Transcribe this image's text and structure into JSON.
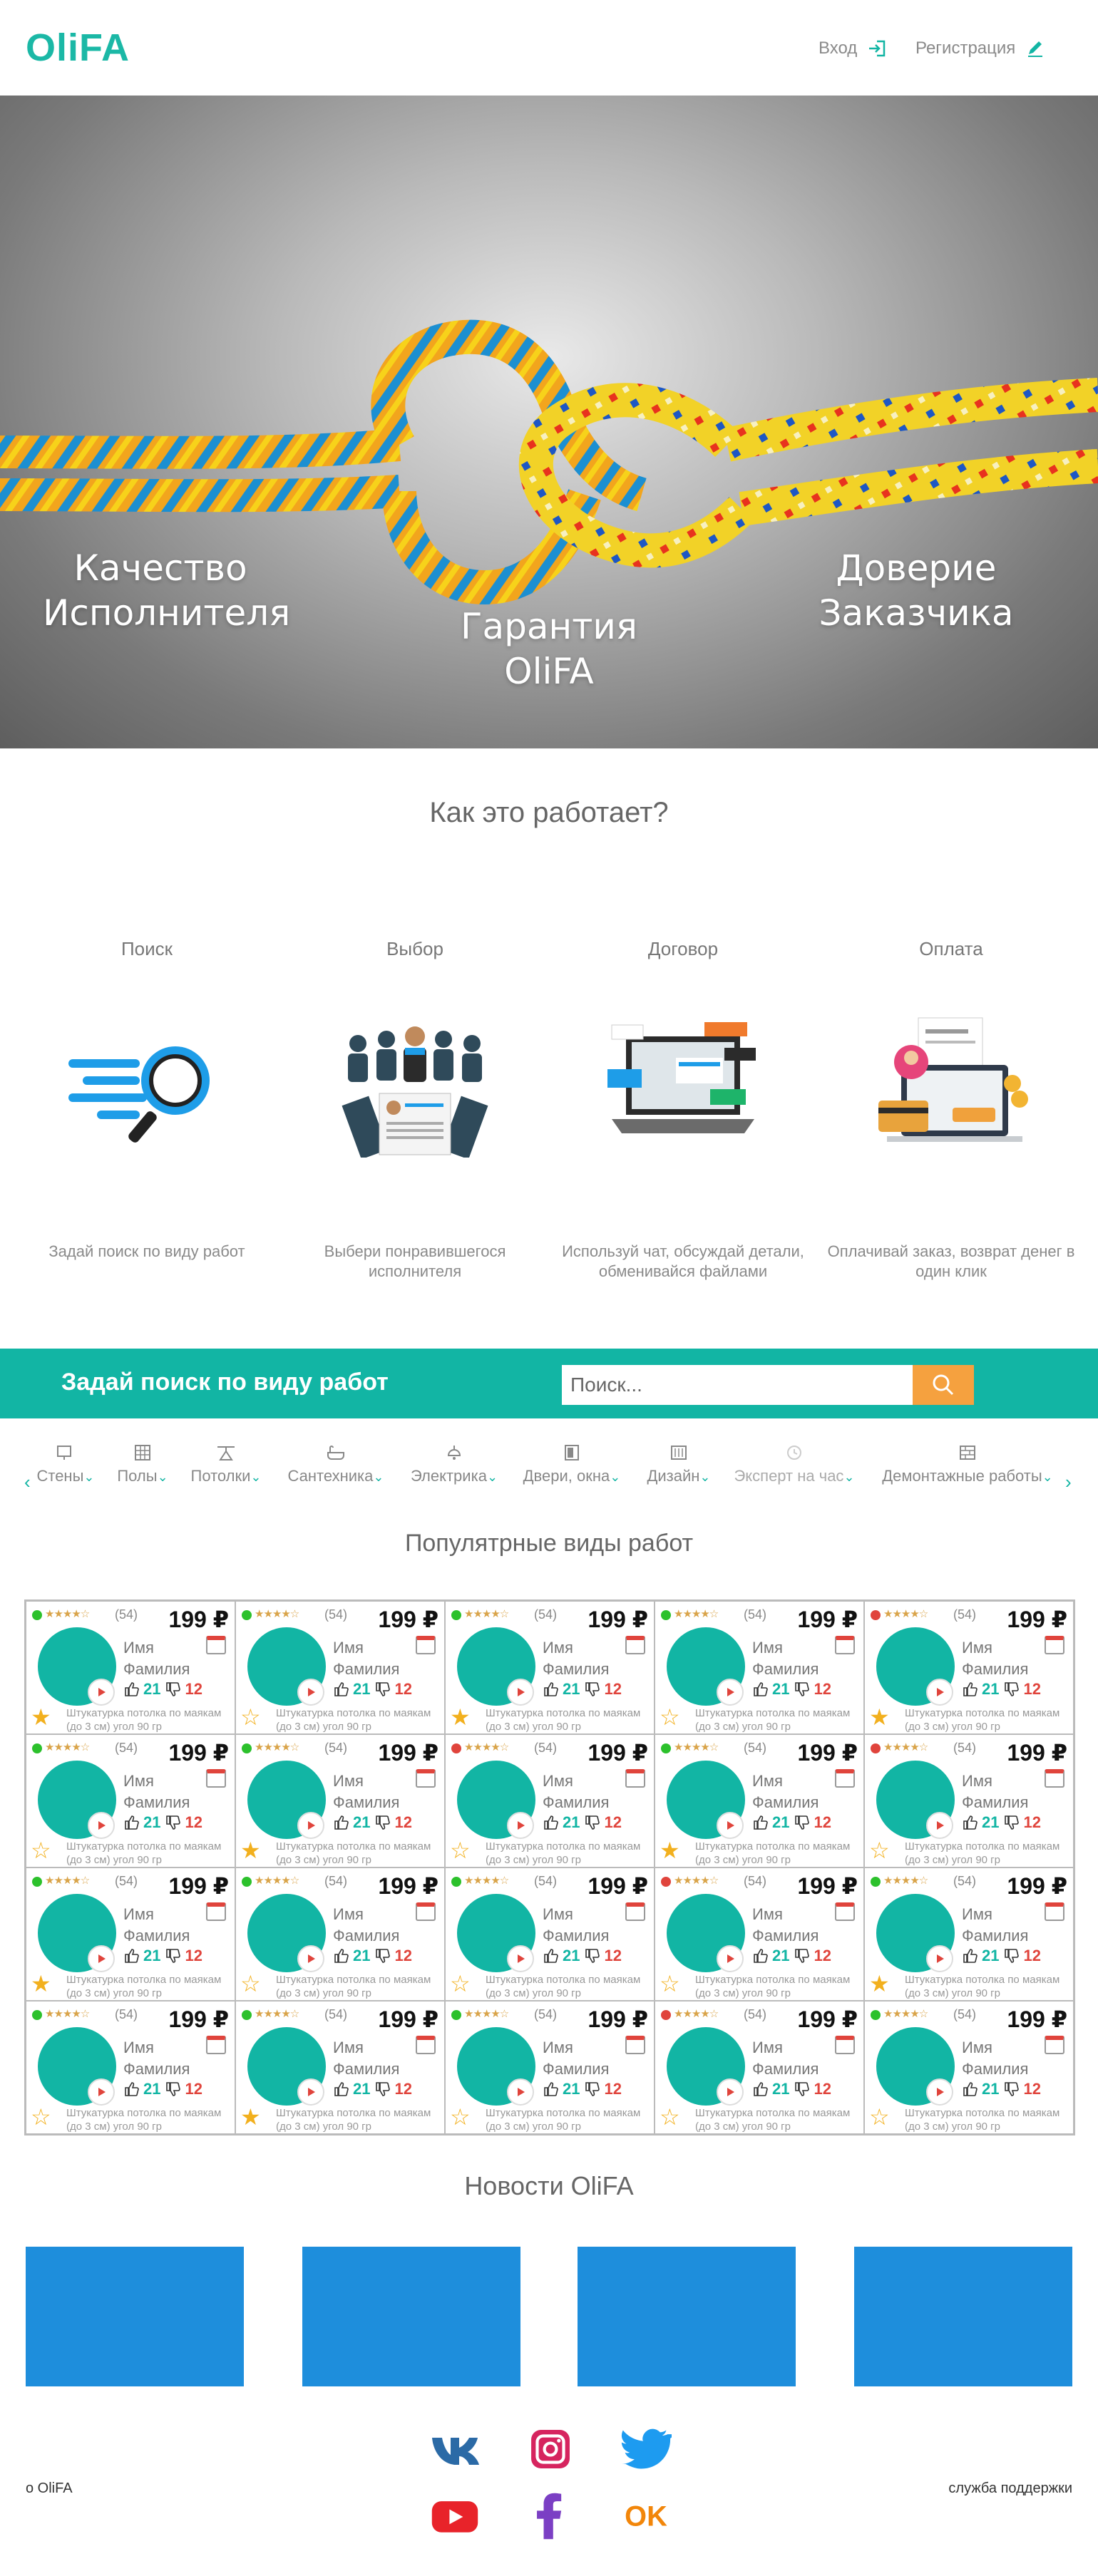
{
  "header": {
    "logo": "OliFA",
    "login": "Вход",
    "register": "Регистрация"
  },
  "hero": {
    "left": "Качество Исполнителя",
    "center": "Гарантия OliFA",
    "right": "Доверие Заказчика"
  },
  "how": {
    "title": "Как это работает?",
    "steps": [
      {
        "title": "Поиск",
        "desc": "Задай поиск по виду работ"
      },
      {
        "title": "Выбор",
        "desc": "Выбери понравившегося исполнителя"
      },
      {
        "title": "Договор",
        "desc": "Используй чат, обсуждай детали, обменивайся файлами"
      },
      {
        "title": "Оплата",
        "desc": "Оплачивай заказ, возврат денег в один клик"
      }
    ]
  },
  "search": {
    "title": "Задай поиск по виду работ",
    "placeholder": "Поиск..."
  },
  "categories": [
    {
      "label": "Стены"
    },
    {
      "label": "Полы"
    },
    {
      "label": "Потолки"
    },
    {
      "label": "Сантехника"
    },
    {
      "label": "Электрика"
    },
    {
      "label": "Двери, окна"
    },
    {
      "label": "Дизайн"
    },
    {
      "label": "Эксперт на час"
    },
    {
      "label": "Демонтажные работы"
    }
  ],
  "popular": {
    "title": "Популятрные виды работ",
    "card": {
      "count": "(54)",
      "price": "199 ₽",
      "first_name": "Имя",
      "last_name": "Фамилия",
      "likes": "21",
      "dislikes": "12",
      "desc": "Штукатурка потолка по маякам (до 3 см) угол 90 гр"
    },
    "status_colors": [
      "green",
      "green",
      "green",
      "green",
      "red",
      "green",
      "green",
      "red",
      "green",
      "red",
      "green",
      "green",
      "green",
      "red",
      "green",
      "green",
      "green",
      "green",
      "red",
      "green"
    ],
    "fav_filled": [
      true,
      false,
      true,
      false,
      true,
      false,
      true,
      false,
      true,
      false,
      true,
      false,
      false,
      false,
      true,
      false,
      true,
      false,
      false,
      false
    ]
  },
  "news": {
    "title": "Новости OliFA"
  },
  "footer": {
    "about": "о OliFA",
    "support": "служба поддержки",
    "socials": [
      "vk-icon",
      "instagram-icon",
      "twitter-icon",
      "youtube-icon",
      "facebook-icon",
      "odnoklassniki-icon"
    ]
  },
  "colors": {
    "brand": "#12b5a4",
    "accent": "#f5a13f",
    "news": "#1e8edc"
  }
}
